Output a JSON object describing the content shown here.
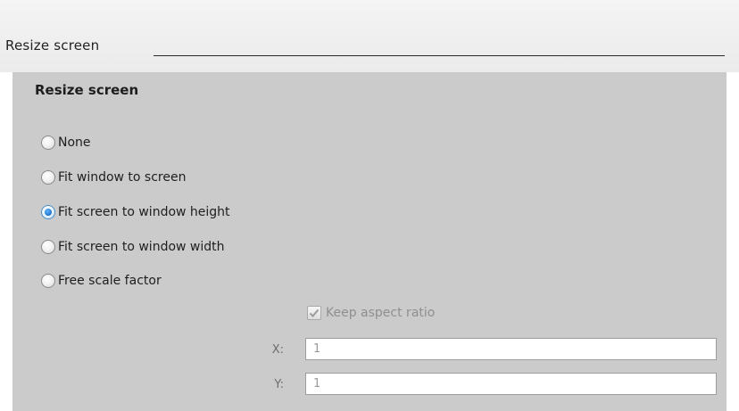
{
  "section": {
    "title": "Resize screen"
  },
  "group": {
    "title": "Resize screen",
    "options": [
      {
        "label": "None",
        "selected": false
      },
      {
        "label": "Fit window to screen",
        "selected": false
      },
      {
        "label": "Fit screen to window height",
        "selected": true
      },
      {
        "label": "Fit screen to window width",
        "selected": false
      },
      {
        "label": "Free scale factor",
        "selected": false
      }
    ]
  },
  "aspect": {
    "label": "Keep aspect ratio",
    "checked": true,
    "enabled": false
  },
  "fields": {
    "x_label": "X:",
    "x_value": "1",
    "y_label": "Y:",
    "y_value": "1"
  },
  "colors": {
    "panel_bg": "#cbcbcb",
    "radio_selected": "#1e72c8"
  }
}
